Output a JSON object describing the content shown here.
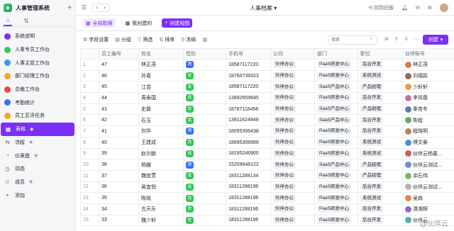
{
  "app": {
    "title": "人事管理系统",
    "doc_title": "人事档案"
  },
  "topbar": {
    "history": "回到旧版"
  },
  "sidebar": {
    "items": [
      {
        "label": "系统说明",
        "color": "#7b2ff7",
        "eye": false
      },
      {
        "label": "人事专员工作台",
        "color": "#34c759",
        "eye": false
      },
      {
        "label": "人事主管工作台",
        "color": "#2ba0f0",
        "eye": false
      },
      {
        "label": "部门经理工作台",
        "color": "#f5a623",
        "eye": false
      },
      {
        "label": "总裁工作台",
        "color": "#e84749",
        "eye": false
      },
      {
        "label": "考勤统计",
        "color": "#3370ff",
        "eye": false
      },
      {
        "label": "员工互评任务",
        "color": "#f5a623",
        "eye": false
      },
      {
        "label": "表格",
        "color": "#ffffff",
        "eye": true,
        "active": true
      },
      {
        "label": "流程",
        "color": "#646a73",
        "eye": true
      },
      {
        "label": "仪表盘",
        "color": "#646a73",
        "eye": true
      },
      {
        "label": "动态",
        "color": "#646a73",
        "eye": false
      },
      {
        "label": "成员",
        "color": "#646a73",
        "eye": true
      },
      {
        "label": "添加",
        "color": "#646a73",
        "eye": false
      }
    ]
  },
  "views": [
    "全部数据",
    "我创建的",
    "创建视图"
  ],
  "toolbar": {
    "fields": "字段设置",
    "group": "分组",
    "filter": "筛选",
    "sort": "排序",
    "freeze": "冻结",
    "search_placeholder": "搜索",
    "create": "创建"
  },
  "table": {
    "columns": [
      "",
      "员工编号",
      "姓名",
      "性别",
      "手机号",
      "公司",
      "部门",
      "职位",
      "伙伴账号"
    ],
    "rows": [
      [
        "1",
        "47",
        "林正茂",
        "男",
        "18587117220",
        "伙伴办公",
        "PaaS研发中心",
        "后台开发",
        "林正茂"
      ],
      [
        "2",
        "46",
        "孙喜",
        "女",
        "18760739323",
        "伙伴办公",
        "PaaS研发中心",
        "系统测试",
        "刘福民"
      ],
      [
        "3",
        "45",
        "江芸",
        "女",
        "18587117220",
        "伙伴办公",
        "SaaS产品中心",
        "产品经理",
        "少轩轩"
      ],
      [
        "4",
        "44",
        "周泰国",
        "女",
        "13892659645",
        "伙伴办公",
        "PaaS研发中心",
        "后台开发",
        "李凤霞"
      ],
      [
        "5",
        "43",
        "史磊",
        "女",
        "18787116458",
        "伙伴办公",
        "SaaS产品中心",
        "产品助理",
        "秦杏冬"
      ],
      [
        "6",
        "42",
        "石玉",
        "女",
        "13811624949",
        "伙伴办公",
        "SaaS产品中心",
        "后台开发",
        "陈程"
      ],
      [
        "7",
        "41",
        "刘华",
        "男",
        "18095306438",
        "伙伴办公",
        "PaaS研发中心",
        "后台开发",
        "程晓明"
      ],
      [
        "8",
        "40",
        "王建成",
        "女",
        "18695308966",
        "伙伴办公",
        "PaaS研发中心",
        "系统测试",
        "傅文豪"
      ],
      [
        "9",
        "39",
        "赵尔鹏",
        "女",
        "18195246900",
        "伙伴办公",
        "PaaS研发中心",
        "系统测试",
        "伙伴云杨嘉..."
      ],
      [
        "10",
        "38",
        "杨娜",
        "男",
        "15209646122",
        "伙伴办公",
        "SaaS产品中心",
        "产品经理",
        "伙伴云测试..."
      ],
      [
        "11",
        "37",
        "魏宣萱",
        "女",
        "18311288134",
        "伙伴办公",
        "PaaS研发中心",
        "产品经理",
        "余石伟"
      ],
      [
        "12",
        "36",
        "吴宜倪",
        "女",
        "18311288196",
        "伙伴办公",
        "PaaS研发中心",
        "后台开发",
        "伙伴云测试..."
      ],
      [
        "13",
        "35",
        "陈晓",
        "女",
        "18311288196",
        "伙伴办公",
        "PaaS研发中心",
        "系统测试",
        "吴舆"
      ],
      [
        "14",
        "34",
        "古天乐",
        "女",
        "18311288196",
        "伙伴办公",
        "PaaS研发中心",
        "后台开发",
        "潇湘辉"
      ],
      [
        "15",
        "33",
        "魏少轩",
        "女",
        "18311288196",
        "伙伴办公",
        "PaaS研发中心",
        "后台开发",
        "伙伴云"
      ]
    ],
    "avatar_colors": [
      "#d97b4a",
      "#8a6d5a",
      "#e2a23b",
      "#c96f9a",
      "#5a7fb8",
      "#6aa86a",
      "#b58855",
      "#4a90d9",
      "#d45d5d",
      "#6d8fd1",
      "#7bb36a",
      "#b6b6b6",
      "#d98a4a",
      "#8e6bd1",
      "#5aaea5"
    ]
  },
  "watermark": "@伙伴云"
}
